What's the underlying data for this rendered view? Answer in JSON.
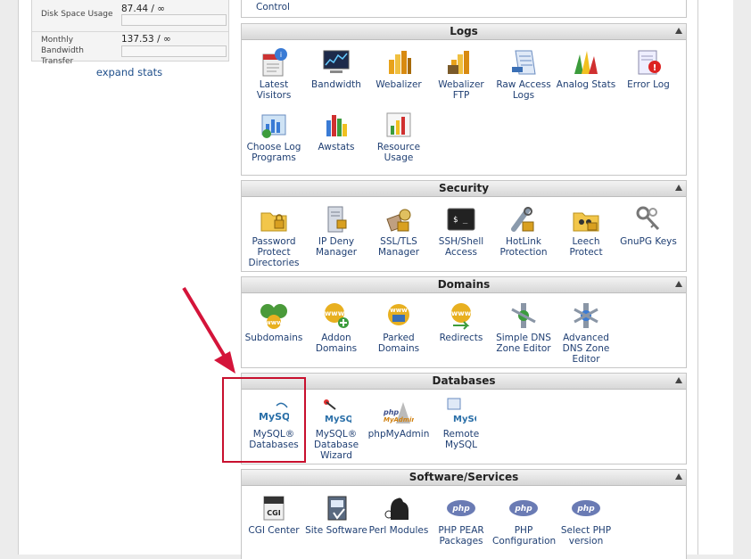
{
  "stats": {
    "disk_label": "Disk Space Usage",
    "disk_value": "87.44 / ∞",
    "bandwidth_label": "Monthly Bandwidth Transfer",
    "bandwidth_value": "137.53 / ∞",
    "expand": "expand stats"
  },
  "top_item": {
    "label": "Control"
  },
  "groups": {
    "logs": {
      "title": "Logs",
      "items": [
        {
          "label": "Latest Visitors",
          "icon": "visitors-icon"
        },
        {
          "label": "Bandwidth",
          "icon": "bandwidth-icon"
        },
        {
          "label": "Webalizer",
          "icon": "webalizer-icon"
        },
        {
          "label": "Webalizer FTP",
          "icon": "webalizer-ftp-icon"
        },
        {
          "label": "Raw Access Logs",
          "icon": "raw-logs-icon"
        },
        {
          "label": "Analog Stats",
          "icon": "analog-stats-icon"
        },
        {
          "label": "Error Log",
          "icon": "error-log-icon"
        },
        {
          "label": "Choose Log Programs",
          "icon": "log-programs-icon"
        },
        {
          "label": "Awstats",
          "icon": "awstats-icon"
        },
        {
          "label": "Resource Usage",
          "icon": "resource-usage-icon"
        }
      ]
    },
    "security": {
      "title": "Security",
      "items": [
        {
          "label": "Password Protect Directories",
          "icon": "password-folder-icon"
        },
        {
          "label": "IP Deny Manager",
          "icon": "ip-deny-icon"
        },
        {
          "label": "SSL/TLS Manager",
          "icon": "ssl-icon"
        },
        {
          "label": "SSH/Shell Access",
          "icon": "terminal-icon"
        },
        {
          "label": "HotLink Protection",
          "icon": "hotlink-icon"
        },
        {
          "label": "Leech Protect",
          "icon": "leech-icon"
        },
        {
          "label": "GnuPG Keys",
          "icon": "keys-icon"
        }
      ]
    },
    "domains": {
      "title": "Domains",
      "items": [
        {
          "label": "Subdomains",
          "icon": "subdomains-icon"
        },
        {
          "label": "Addon Domains",
          "icon": "addon-domains-icon"
        },
        {
          "label": "Parked Domains",
          "icon": "parked-domains-icon"
        },
        {
          "label": "Redirects",
          "icon": "redirects-icon"
        },
        {
          "label": "Simple DNS Zone Editor",
          "icon": "simple-dns-icon"
        },
        {
          "label": "Advanced DNS Zone Editor",
          "icon": "advanced-dns-icon"
        }
      ]
    },
    "databases": {
      "title": "Databases",
      "items": [
        {
          "label": "MySQL® Databases",
          "icon": "mysql-icon"
        },
        {
          "label": "MySQL® Database Wizard",
          "icon": "mysql-wizard-icon"
        },
        {
          "label": "phpMyAdmin",
          "icon": "phpmyadmin-icon"
        },
        {
          "label": "Remote MySQL",
          "icon": "remote-mysql-icon"
        }
      ]
    },
    "software": {
      "title": "Software/Services",
      "items": [
        {
          "label": "CGI Center",
          "icon": "cgi-icon"
        },
        {
          "label": "Site Software",
          "icon": "site-software-icon"
        },
        {
          "label": "Perl Modules",
          "icon": "perl-icon"
        },
        {
          "label": "PHP PEAR Packages",
          "icon": "php-icon"
        },
        {
          "label": "PHP Configuration",
          "icon": "php-icon"
        },
        {
          "label": "Select PHP version",
          "icon": "php-icon"
        }
      ]
    }
  },
  "icon_text": {
    "mysql": "MySQL",
    "php": "php",
    "cgi": "CGI",
    "phpmyadmin_top": "php",
    "phpmyadmin_bottom": "MyAdmin",
    "www": "www",
    "terminal": "$ _"
  }
}
